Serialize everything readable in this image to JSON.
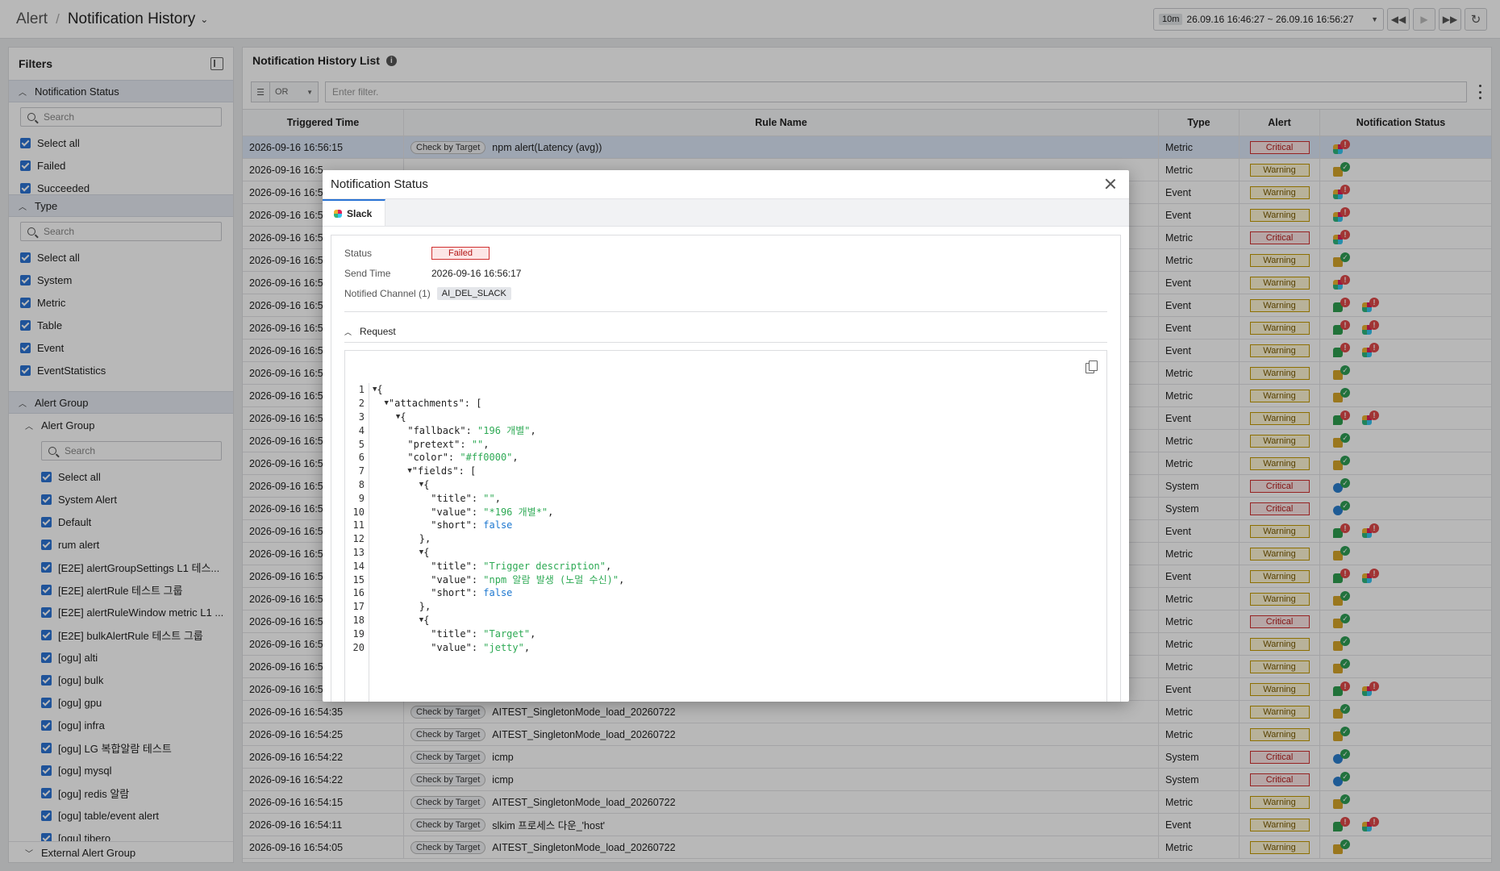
{
  "breadcrumb": {
    "parent": "Alert",
    "current": "Notification History"
  },
  "time_range": {
    "preset": "10m",
    "range": "26.09.16 16:46:27 ~ 26.09.16 16:56:27"
  },
  "filters": {
    "title": "Filters",
    "notification_status": {
      "label": "Notification Status",
      "search_placeholder": "Search",
      "items": [
        "Select all",
        "Failed",
        "Succeeded"
      ]
    },
    "type": {
      "label": "Type",
      "search_placeholder": "Search",
      "items": [
        "Select all",
        "System",
        "Metric",
        "Table",
        "Event",
        "EventStatistics"
      ]
    },
    "alert_group": {
      "label": "Alert Group",
      "sub_label": "Alert Group",
      "search_placeholder": "Search",
      "items": [
        "Select all",
        "System Alert",
        "Default",
        "rum alert",
        "[E2E] alertGroupSettings L1 테스...",
        "[E2E] alertRule 테스트 그룹",
        "[E2E] alertRuleWindow metric L1 ...",
        "[E2E] bulkAlertRule 테스트 그룹",
        "[ogu] alti",
        "[ogu] bulk",
        "[ogu] gpu",
        "[ogu] infra",
        "[ogu] LG 복합알람 테스트",
        "[ogu] mysql",
        "[ogu] redis 알람",
        "[ogu] table/event alert",
        "[ogu] tibero"
      ],
      "external_label": "External Alert Group"
    }
  },
  "list": {
    "title": "Notification History List",
    "filter_mode": "OR",
    "filter_placeholder": "Enter filter.",
    "columns": {
      "time": "Triggered Time",
      "rule": "Rule Name",
      "type": "Type",
      "alert": "Alert",
      "ns": "Notification Status"
    },
    "rule_tag": "Check by Target",
    "first_row": {
      "time": "2026-09-16 16:56:15",
      "rule": "npm alert(Latency (avg))",
      "type": "Metric",
      "alert": "Critical"
    },
    "rows_behind_modal": [
      {
        "time": "2026-09-16 16:5",
        "type": "Metric",
        "alert": "Warning",
        "ns": [
          [
            "mail",
            "ok"
          ]
        ]
      },
      {
        "time": "2026-09-16 16:5",
        "type": "Event",
        "alert": "Warning",
        "ns": [
          [
            "slack",
            "fail"
          ]
        ]
      },
      {
        "time": "2026-09-16 16:5",
        "type": "Event",
        "alert": "Warning",
        "ns": [
          [
            "slack",
            "fail"
          ]
        ]
      },
      {
        "time": "2026-09-16 16:5",
        "type": "Metric",
        "alert": "Critical",
        "ns": [
          [
            "slack",
            "fail"
          ]
        ]
      },
      {
        "time": "2026-09-16 16:5",
        "type": "Metric",
        "alert": "Warning",
        "ns": [
          [
            "mail",
            "ok"
          ]
        ]
      },
      {
        "time": "2026-09-16 16:5",
        "type": "Event",
        "alert": "Warning",
        "ns": [
          [
            "slack",
            "fail"
          ]
        ]
      },
      {
        "time": "2026-09-16 16:5",
        "type": "Event",
        "alert": "Warning",
        "ns": [
          [
            "chat",
            "fail"
          ],
          [
            "slack",
            "fail"
          ]
        ]
      },
      {
        "time": "2026-09-16 16:5",
        "type": "Event",
        "alert": "Warning",
        "ns": [
          [
            "chat",
            "fail"
          ],
          [
            "slack",
            "fail"
          ]
        ]
      },
      {
        "time": "2026-09-16 16:5",
        "type": "Event",
        "alert": "Warning",
        "ns": [
          [
            "chat",
            "fail"
          ],
          [
            "slack",
            "fail"
          ]
        ]
      },
      {
        "time": "2026-09-16 16:5",
        "type": "Metric",
        "alert": "Warning",
        "ns": [
          [
            "mail",
            "ok"
          ]
        ]
      },
      {
        "time": "2026-09-16 16:5",
        "type": "Metric",
        "alert": "Warning",
        "ns": [
          [
            "mail",
            "ok"
          ]
        ]
      },
      {
        "time": "2026-09-16 16:5",
        "type": "Event",
        "alert": "Warning",
        "ns": [
          [
            "chat",
            "fail"
          ],
          [
            "slack",
            "fail"
          ]
        ]
      },
      {
        "time": "2026-09-16 16:5",
        "type": "Metric",
        "alert": "Warning",
        "ns": [
          [
            "mail",
            "ok"
          ]
        ]
      },
      {
        "time": "2026-09-16 16:5",
        "type": "Metric",
        "alert": "Warning",
        "ns": [
          [
            "mail",
            "ok"
          ]
        ]
      },
      {
        "time": "2026-09-16 16:5",
        "type": "System",
        "alert": "Critical",
        "ns": [
          [
            "tele",
            "ok"
          ]
        ]
      },
      {
        "time": "2026-09-16 16:5",
        "type": "System",
        "alert": "Critical",
        "ns": [
          [
            "tele",
            "ok"
          ]
        ]
      },
      {
        "time": "2026-09-16 16:5",
        "type": "Event",
        "alert": "Warning",
        "ns": [
          [
            "chat",
            "fail"
          ],
          [
            "slack",
            "fail"
          ]
        ]
      },
      {
        "time": "2026-09-16 16:5",
        "type": "Metric",
        "alert": "Warning",
        "ns": [
          [
            "mail",
            "ok"
          ]
        ]
      },
      {
        "time": "2026-09-16 16:5",
        "type": "Event",
        "alert": "Warning",
        "ns": [
          [
            "chat",
            "fail"
          ],
          [
            "slack",
            "fail"
          ]
        ]
      },
      {
        "time": "2026-09-16 16:5",
        "type": "Metric",
        "alert": "Warning",
        "ns": [
          [
            "mail",
            "ok"
          ]
        ]
      },
      {
        "time": "2026-09-16 16:5",
        "type": "Metric",
        "alert": "Critical",
        "ns": [
          [
            "mail",
            "ok"
          ]
        ]
      },
      {
        "time": "2026-09-16 16:5",
        "type": "Metric",
        "alert": "Warning",
        "ns": [
          [
            "mail",
            "ok"
          ]
        ]
      },
      {
        "time": "2026-09-16 16:5",
        "type": "Metric",
        "alert": "Warning",
        "ns": [
          [
            "mail",
            "ok"
          ]
        ]
      },
      {
        "time": "2026-09-16 16:5",
        "type": "Event",
        "alert": "Warning",
        "ns": [
          [
            "chat",
            "fail"
          ],
          [
            "slack",
            "fail"
          ]
        ]
      }
    ],
    "rows_visible": [
      {
        "time": "2026-09-16 16:54:35",
        "rule": "AITEST_SingletonMode_load_20260722",
        "type": "Metric",
        "alert": "Warning",
        "ns": [
          [
            "mail",
            "ok"
          ]
        ]
      },
      {
        "time": "2026-09-16 16:54:25",
        "rule": "AITEST_SingletonMode_load_20260722",
        "type": "Metric",
        "alert": "Warning",
        "ns": [
          [
            "mail",
            "ok"
          ]
        ]
      },
      {
        "time": "2026-09-16 16:54:22",
        "rule": "icmp",
        "type": "System",
        "alert": "Critical",
        "ns": [
          [
            "tele",
            "ok"
          ]
        ]
      },
      {
        "time": "2026-09-16 16:54:22",
        "rule": "icmp",
        "type": "System",
        "alert": "Critical",
        "ns": [
          [
            "tele",
            "ok"
          ]
        ]
      },
      {
        "time": "2026-09-16 16:54:15",
        "rule": "AITEST_SingletonMode_load_20260722",
        "type": "Metric",
        "alert": "Warning",
        "ns": [
          [
            "mail",
            "ok"
          ]
        ]
      },
      {
        "time": "2026-09-16 16:54:11",
        "rule": "slkim 프로세스 다운_'host'",
        "type": "Event",
        "alert": "Warning",
        "ns": [
          [
            "chat",
            "fail"
          ],
          [
            "slack",
            "fail"
          ]
        ]
      },
      {
        "time": "2026-09-16 16:54:05",
        "rule": "AITEST_SingletonMode_load_20260722",
        "type": "Metric",
        "alert": "Warning",
        "ns": [
          [
            "mail",
            "ok"
          ]
        ]
      }
    ]
  },
  "modal": {
    "title": "Notification Status",
    "tab": "Slack",
    "status_label": "Status",
    "status_value": "Failed",
    "send_time_label": "Send Time",
    "send_time_value": "2026-09-16 16:56:17",
    "channel_label": "Notified Channel (1)",
    "channel_value": "AI_DEL_SLACK",
    "request_label": "Request",
    "code_lines": [
      [
        "{"
      ],
      [
        "  \"attachments\": ["
      ],
      [
        "    {"
      ],
      [
        "      \"fallback\": ",
        "\"196 개별\"",
        ","
      ],
      [
        "      \"pretext\": ",
        "\"\"",
        ","
      ],
      [
        "      \"color\": ",
        "\"#ff0000\"",
        ","
      ],
      [
        "      \"fields\": ["
      ],
      [
        "        {"
      ],
      [
        "          \"title\": ",
        "\"\"",
        ","
      ],
      [
        "          \"value\": ",
        "\"*196 개별*\"",
        ","
      ],
      [
        "          \"short\": ",
        "false"
      ],
      [
        "        },"
      ],
      [
        "        {"
      ],
      [
        "          \"title\": ",
        "\"Trigger description\"",
        ","
      ],
      [
        "          \"value\": ",
        "\"npm 알람 발생 (노멀 수신)\"",
        ","
      ],
      [
        "          \"short\": ",
        "false"
      ],
      [
        "        },"
      ],
      [
        "        {"
      ],
      [
        "          \"title\": ",
        "\"Target\"",
        ","
      ],
      [
        "          \"value\": ",
        "\"jetty\"",
        ","
      ]
    ]
  },
  "colors": {
    "accent": "#2b74d4",
    "critical": "#d03030",
    "warning": "#c49a00",
    "ok": "#2f9e55",
    "fail": "#e04848"
  }
}
